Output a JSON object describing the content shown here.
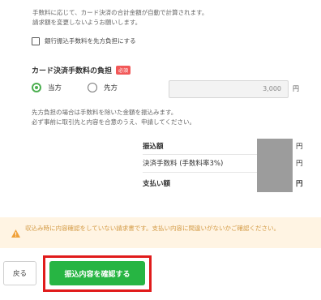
{
  "intro_note": {
    "line1": "手数料に応じて、カード決済の合計金額が自動で計算されます。",
    "line2": "請求額を変更しないようお願いします。"
  },
  "bank_fee_checkbox": {
    "label": "銀行振込手数料を先方負担にする",
    "checked": false
  },
  "card_fee": {
    "title": "カード決済手数料の負担",
    "required_badge": "必須",
    "options": [
      {
        "label": "当方",
        "selected": true
      },
      {
        "label": "先方",
        "selected": false
      }
    ],
    "amount_placeholder": "3,000",
    "unit": "円",
    "note_line1": "先方負担の場合は手数料を除いた金額を振込みます。",
    "note_line2": "必ず事前に取引先と内容を合意のうえ、申請してください。"
  },
  "summary": {
    "rows": [
      {
        "label": "振込額",
        "unit": "円"
      },
      {
        "label": "決済手数料 (手数料率3%)",
        "unit": "円"
      },
      {
        "label": "支払い額",
        "unit": "円"
      }
    ]
  },
  "warning": {
    "text": "収込み時に内容確認をしていない請求書です。支払い内容に間違いがないかご確認ください。"
  },
  "footer": {
    "back_label": "戻る",
    "confirm_label": "振込内容を確認する"
  },
  "colors": {
    "accent_green": "#27b543",
    "highlight_red": "#e01b1b",
    "warning_bg": "#fff4e3",
    "warning_icon": "#f0a13a",
    "required_badge": "#f25858"
  }
}
